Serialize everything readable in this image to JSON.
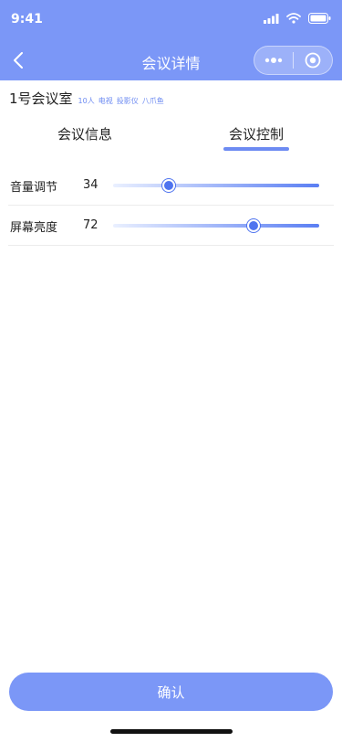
{
  "status_bar": {
    "time": "9:41",
    "icons": [
      "signal-icon",
      "wifi-icon",
      "battery-icon"
    ]
  },
  "nav": {
    "title": "会议详情",
    "back_icon": "chevron-left-icon",
    "capsule_icons": [
      "more-dots-icon",
      "close-target-icon"
    ]
  },
  "room": {
    "name": "1号会议室",
    "tags": [
      "10人",
      "电视",
      "投影仪",
      "八爪鱼"
    ]
  },
  "tabs": {
    "items": [
      {
        "label": "会议信息",
        "active": false
      },
      {
        "label": "会议控制",
        "active": true
      }
    ]
  },
  "controls": [
    {
      "label": "音量调节",
      "value": "34",
      "fraction": 0.27
    },
    {
      "label": "屏幕亮度",
      "value": "72",
      "fraction": 0.68
    }
  ],
  "footer": {
    "confirm_label": "确认"
  },
  "colors": {
    "primary": "#7b97f7",
    "accent": "#6d8bf2",
    "thumb": "#4f74ef"
  }
}
